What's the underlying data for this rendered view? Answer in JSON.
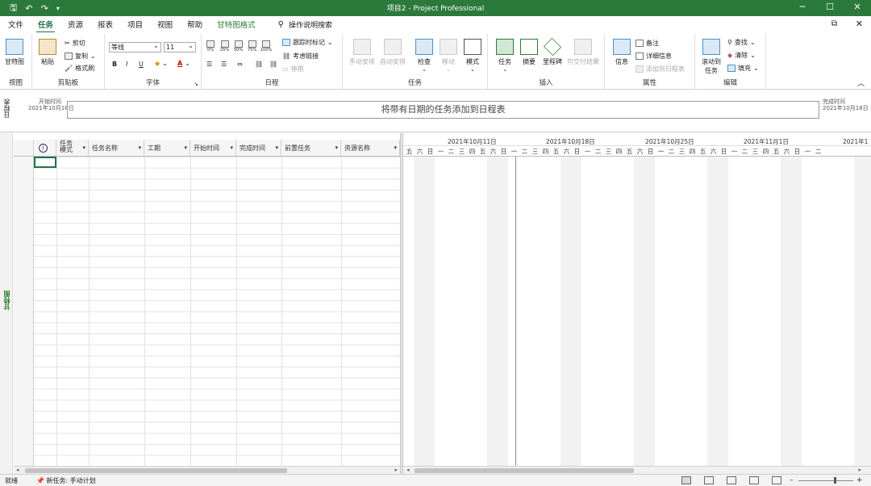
{
  "titlebar": {
    "title": "项目2  -  Project Professional",
    "undo_icon": "undo-icon",
    "redo_icon": "redo-icon",
    "save_icon": "save-icon"
  },
  "menu": {
    "tabs": [
      "文件",
      "任务",
      "资源",
      "报表",
      "项目",
      "视图",
      "帮助",
      "甘特图格式"
    ],
    "active_tab": "任务",
    "search_label": "操作说明搜索"
  },
  "ribbon": {
    "view": {
      "gantt_label": "甘特图",
      "group_label": "视图"
    },
    "clipboard": {
      "paste_label": "粘贴",
      "cut_label": "剪切",
      "copy_label": "复制",
      "format_painter_label": "格式刷",
      "group_label": "剪贴板"
    },
    "font": {
      "font_name": "等线",
      "font_size": "11",
      "bold": "B",
      "italic": "I",
      "underline": "U",
      "group_label": "字体"
    },
    "schedule": {
      "pct_0": "0%",
      "pct_25": "25%",
      "pct_50": "50%",
      "pct_75": "75%",
      "pct_100": "100%",
      "mark_on_track": "跟踪时标记",
      "respect_links": "考虑链接",
      "inactivate": "停用",
      "group_label": "日程"
    },
    "tasks": {
      "manual": "手动安排",
      "auto": "自动安排",
      "inspect": "检查",
      "move": "移动",
      "mode": "模式",
      "group_label": "任务"
    },
    "insert": {
      "task": "任务",
      "summary": "摘要",
      "milestone": "里程碑",
      "deliverable": "可交付结果",
      "group_label": "插入"
    },
    "properties": {
      "info": "信息",
      "notes": "备注",
      "details": "详细信息",
      "add_to_timeline": "添加到日程表",
      "group_label": "属性"
    },
    "editing": {
      "scroll_to_task_1": "滚动到",
      "scroll_to_task_2": "任务",
      "find": "查找",
      "clear": "清除",
      "fill": "填充",
      "group_label": "编辑"
    }
  },
  "timeline": {
    "side_label": "日程表",
    "start_label": "开始时间",
    "start_date": "2021年10月18日",
    "finish_label": "完成时间",
    "finish_date": "2021年10月18日",
    "placeholder": "将带有日期的任务添加到日程表"
  },
  "sheet": {
    "side_label": "甘特图",
    "columns": [
      "任务模式",
      "任务名称",
      "工期",
      "开始时间",
      "完成时间",
      "前置任务",
      "资源名称"
    ],
    "task_mode_line1": "任务",
    "task_mode_line2": "模式",
    "info_icon": "info-icon"
  },
  "gantt": {
    "weeks": [
      "2021年10月11日",
      "2021年10月18日",
      "2021年10月25日",
      "2021年11月1日",
      "2021年1"
    ],
    "days": [
      "五",
      "六",
      "日",
      "一",
      "二",
      "三",
      "四",
      "五",
      "六",
      "日",
      "一",
      "二",
      "三",
      "四",
      "五",
      "六",
      "日",
      "一",
      "二",
      "三",
      "四",
      "五",
      "六",
      "日",
      "一",
      "二",
      "三",
      "四",
      "五",
      "六",
      "日",
      "一",
      "二",
      "三",
      "四",
      "五",
      "六",
      "日",
      "一",
      "二"
    ]
  },
  "status": {
    "ready": "就绪",
    "new_tasks": "新任务: 手动计划"
  }
}
